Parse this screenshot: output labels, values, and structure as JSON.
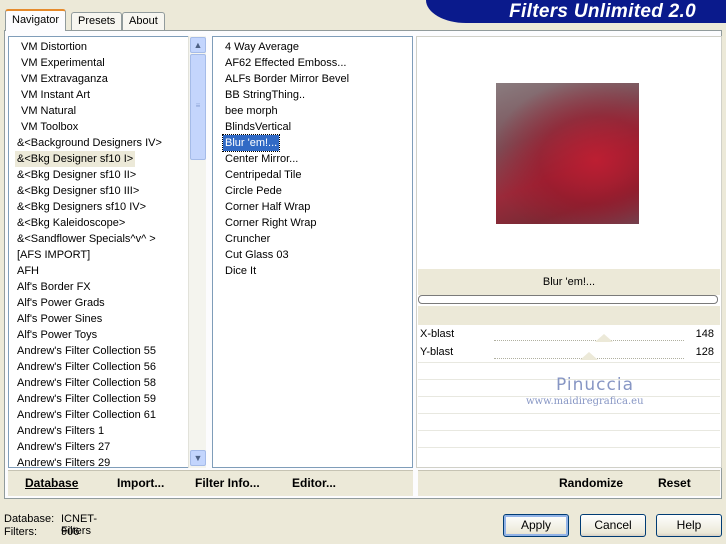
{
  "app": {
    "title": "Filters Unlimited 2.0"
  },
  "tabs": [
    "Navigator",
    "Presets",
    "About"
  ],
  "categories": [
    "VM Distortion",
    "VM Experimental",
    "VM Extravaganza",
    "VM Instant Art",
    "VM Natural",
    "VM Toolbox",
    "&<Background Designers IV>",
    "&<Bkg Designer sf10 I>",
    "&<Bkg Designer sf10 II>",
    "&<Bkg Designer sf10 III>",
    "&<Bkg Designers sf10 IV>",
    "&<Bkg Kaleidoscope>",
    "&<Sandflower Specials^v^ >",
    "[AFS IMPORT]",
    "AFH",
    "Alf's Border FX",
    "Alf's Power Grads",
    "Alf's Power Sines",
    "Alf's Power Toys",
    "Andrew's Filter Collection 55",
    "Andrew's Filter Collection 56",
    "Andrew's Filter Collection 58",
    "Andrew's Filter Collection 59",
    "Andrew's Filter Collection 61",
    "Andrew's Filters 1",
    "Andrew's Filters 27",
    "Andrew's Filters 29"
  ],
  "filters": [
    "4 Way Average",
    "AF62 Effected Emboss...",
    "ALFs Border Mirror Bevel",
    "BB StringThing..",
    "bee morph",
    "BlindsVertical",
    "Blur 'em!...",
    "Center Mirror...",
    "Centripedal Tile",
    "Circle Pede",
    "Corner Half Wrap",
    "Corner Right Wrap",
    "Cruncher",
    "Cut Glass 03",
    "Dice It"
  ],
  "selected_category": "&<Bkg Designer sf10 I>",
  "selected_filter": "Blur 'em!...",
  "preview": {
    "filter_name": "Blur 'em!..."
  },
  "params": [
    {
      "name": "X-blast",
      "value": "148",
      "level": 0.58
    },
    {
      "name": "Y-blast",
      "value": "128",
      "level": 0.5
    }
  ],
  "watermark": {
    "name": "Pinuccia",
    "url": "www.maidiregrafica.eu"
  },
  "left_bar": {
    "database": "Database",
    "import": "Import...",
    "filter_info": "Filter Info...",
    "editor": "Editor..."
  },
  "right_bar": {
    "randomize": "Randomize",
    "reset": "Reset"
  },
  "footer": {
    "database_label": "Database:",
    "database_value": "ICNET-Filters",
    "filters_label": "Filters:",
    "filters_value": "906"
  },
  "buttons": {
    "apply": "Apply",
    "cancel": "Cancel",
    "help": "Help"
  },
  "colors": {
    "banner": "#0a1a8c",
    "selection": "#316ac5",
    "tab_accent": "#e68b2c"
  }
}
